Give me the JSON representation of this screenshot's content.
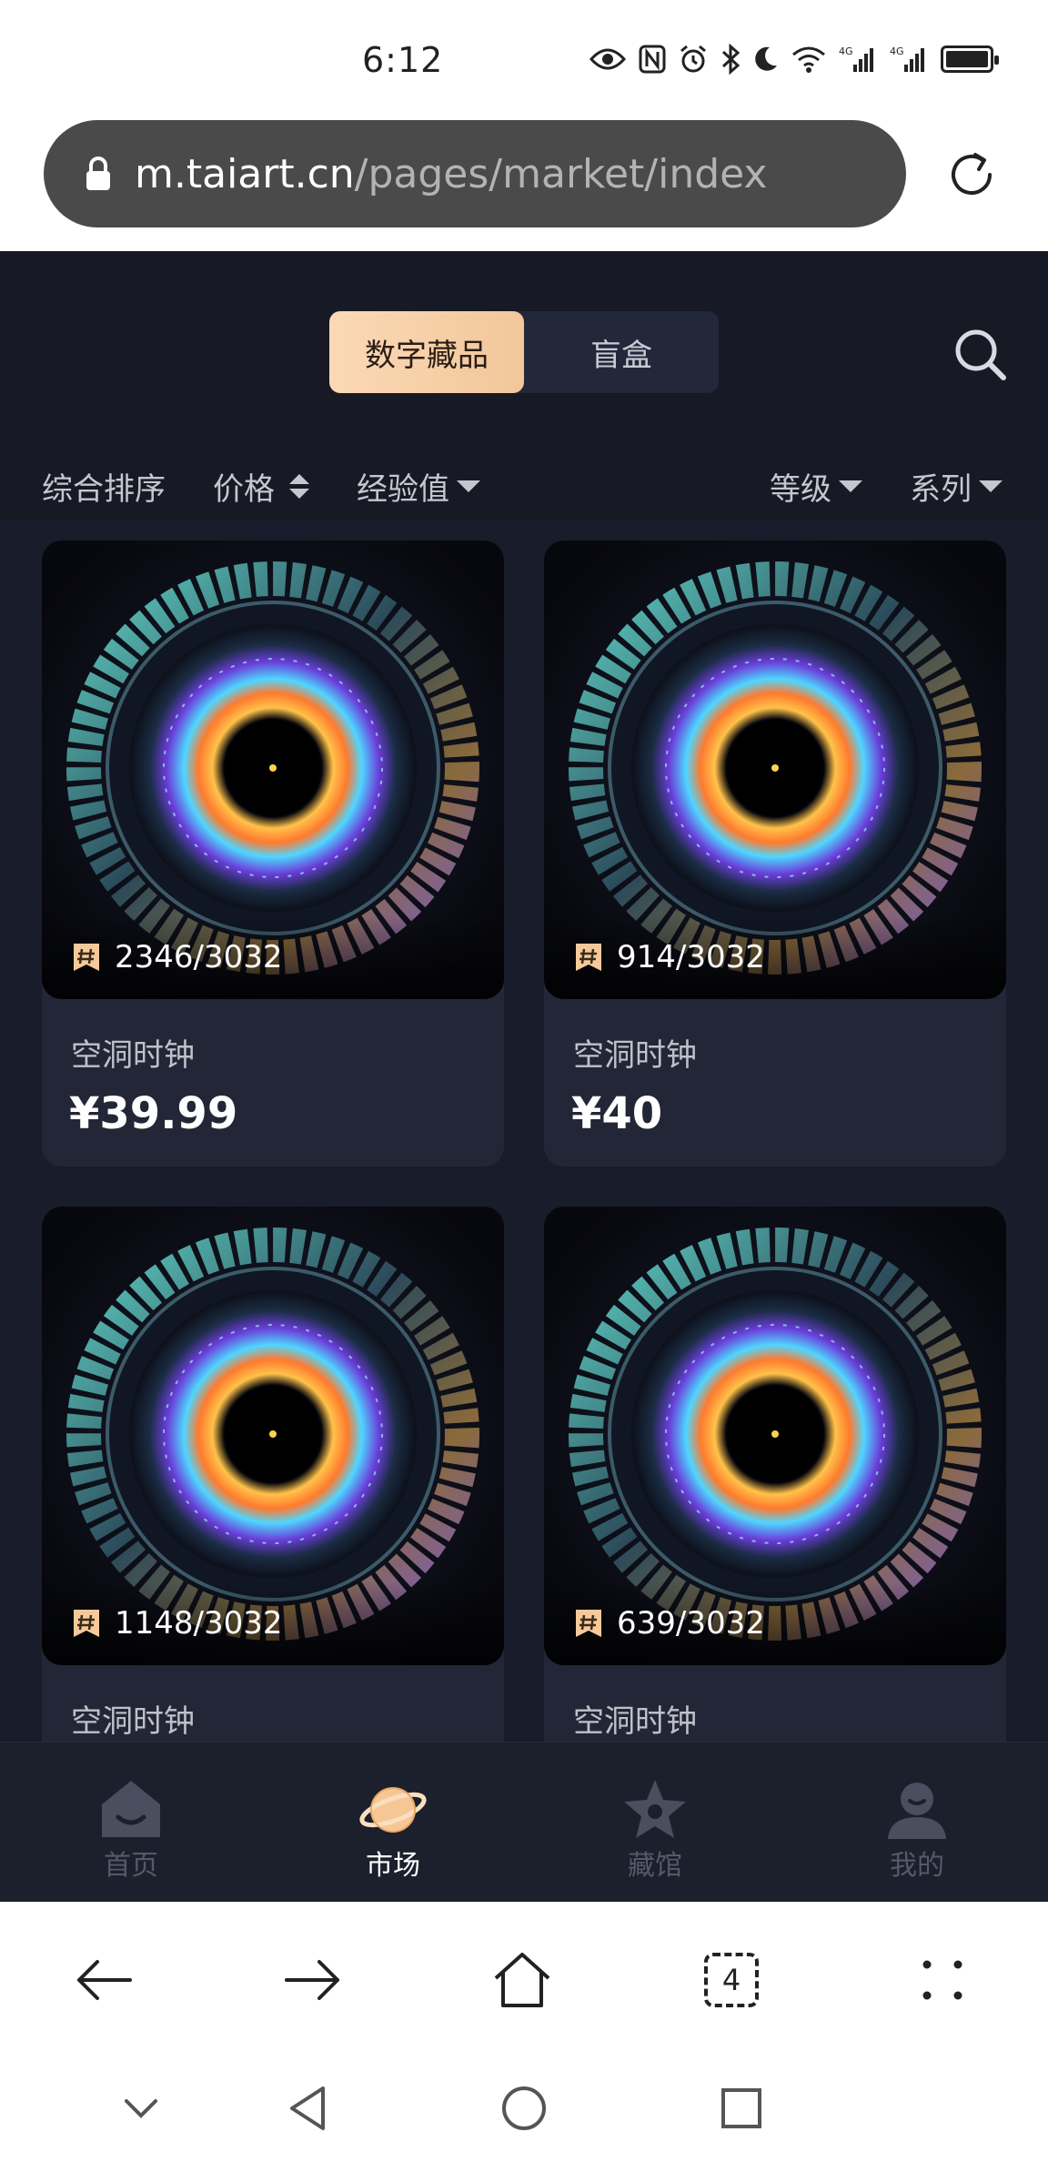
{
  "status_bar": {
    "time": "6:12",
    "icons": [
      "eye-icon",
      "nfc-icon",
      "alarm-icon",
      "bluetooth-icon",
      "moon-icon",
      "wifi-icon",
      "signal-4g-icon",
      "signal-4g-icon",
      "battery-charging-icon"
    ],
    "network_labels": [
      "4G",
      "4G"
    ]
  },
  "browser": {
    "url_host": "m.taiart.cn",
    "url_path": "/pages/market/index",
    "toolbar": {
      "back_icon": "arrow-left-icon",
      "forward_icon": "arrow-right-icon",
      "home_icon": "home-icon",
      "tab_count": "4",
      "menu_icon": "dots-grid-icon"
    }
  },
  "market": {
    "segments": [
      {
        "label": "数字藏品",
        "active": true
      },
      {
        "label": "盲盒",
        "active": false
      }
    ],
    "filters": {
      "sort": "综合排序",
      "price": "价格",
      "experience": "经验值",
      "level": "等级",
      "series": "系列"
    },
    "items": [
      {
        "edition": "2346/3032",
        "name": "空洞时钟",
        "price": "¥39.99"
      },
      {
        "edition": "914/3032",
        "name": "空洞时钟",
        "price": "¥40"
      },
      {
        "edition": "1148/3032",
        "name": "空洞时钟",
        "price": ""
      },
      {
        "edition": "639/3032",
        "name": "空洞时钟",
        "price": ""
      }
    ]
  },
  "tabbar": [
    {
      "label": "首页",
      "icon": "home-tab-icon",
      "active": false
    },
    {
      "label": "市场",
      "icon": "planet-icon",
      "active": true
    },
    {
      "label": "藏馆",
      "icon": "star-icon",
      "active": false
    },
    {
      "label": "我的",
      "icon": "user-icon",
      "active": false
    }
  ],
  "colors": {
    "app_background": "#171a25",
    "card_background": "#232636",
    "accent_gradient_start": "#fbd9b6",
    "accent_gradient_end": "#f2c79a",
    "edition_badge": "#f5c99a"
  }
}
